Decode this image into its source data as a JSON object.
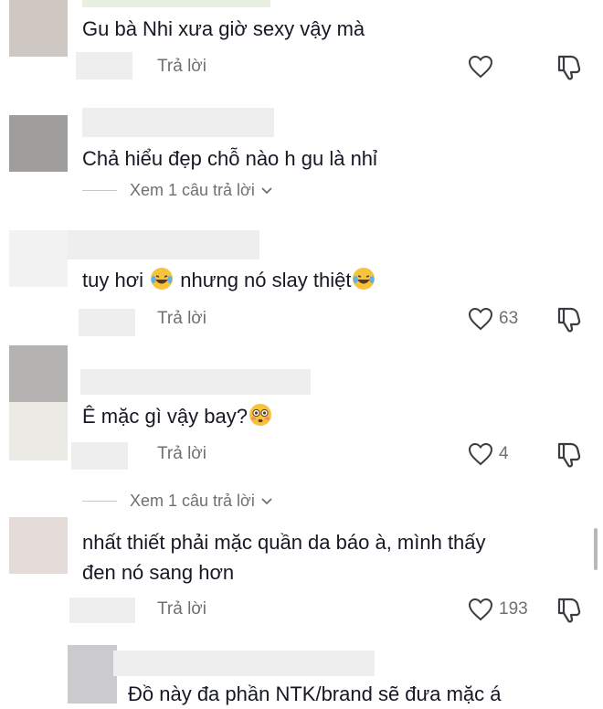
{
  "comments": [
    {
      "text": "Gu bà Nhi xưa giờ sexy vậy mà",
      "reply_label": "Trả lời",
      "likes": ""
    },
    {
      "text": "Chả hiểu đẹp chỗ nào h gu là nhỉ",
      "view_replies": "Xem 1 câu trả lời"
    },
    {
      "text_before": "tuy hơi",
      "text_middle": "nhưng nó slay thiệt",
      "reply_label": "Trả lời",
      "likes": "63"
    },
    {
      "text": "Ê mặc gì vậy bay?",
      "reply_label": "Trả lời",
      "likes": "4",
      "view_replies": "Xem 1 câu trả lời"
    },
    {
      "text_line1": "nhất thiết phải mặc quần da báo à, mình thấy",
      "text_line2": "đen nó sang hơn",
      "reply_label": "Trả lời",
      "likes": "193"
    },
    {
      "text": "Đồ này đa phần NTK/brand sẽ đưa mặc á"
    }
  ],
  "emoji": {
    "laughing": "laughing-tears-emoji",
    "flushed": "flushed-face-emoji"
  },
  "colors": {
    "text": "#161823",
    "secondary": "#6f7074",
    "placeholder": "#eeeeee"
  }
}
